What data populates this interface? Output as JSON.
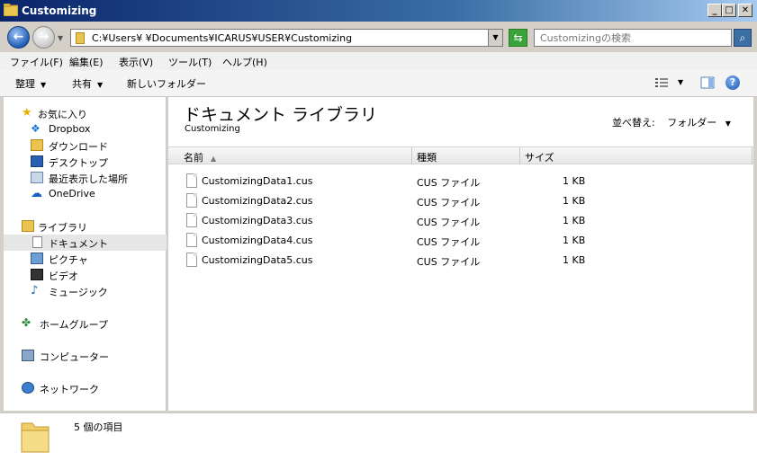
{
  "window": {
    "title": "Customizing"
  },
  "window_buttons": {
    "minimize": "_",
    "maximize": "□",
    "close": "✕"
  },
  "address": {
    "path": "C:¥Users¥    ¥Documents¥ICARUS¥USER¥Customizing"
  },
  "search": {
    "placeholder": "Customizingの検索"
  },
  "menu": {
    "items": [
      "ファイル(F)",
      "編集(E)",
      "表示(V)",
      "ツール(T)",
      "ヘルプ(H)"
    ]
  },
  "toolbar": {
    "organize": "整理",
    "share": "共有",
    "new_folder": "新しいフォルダー"
  },
  "nav": {
    "favorites": "お気に入り",
    "dropbox": "Dropbox",
    "downloads": "ダウンロード",
    "desktop": "デスクトップ",
    "recent": "最近表示した場所",
    "onedrive": "OneDrive",
    "libraries": "ライブラリ",
    "documents": "ドキュメント",
    "pictures": "ピクチャ",
    "videos": "ビデオ",
    "music": "ミュージック",
    "homegroup": "ホームグループ",
    "computer": "コンピューター",
    "network": "ネットワーク"
  },
  "library": {
    "title": "ドキュメント ライブラリ",
    "subtitle": "Customizing",
    "sort_label": "並べ替え:",
    "sort_value": "フォルダー"
  },
  "columns": {
    "name": "名前",
    "type": "種類",
    "size": "サイズ"
  },
  "files": [
    {
      "name": "CustomizingData1.cus",
      "type": "CUS ファイル",
      "size": "1 KB"
    },
    {
      "name": "CustomizingData2.cus",
      "type": "CUS ファイル",
      "size": "1 KB"
    },
    {
      "name": "CustomizingData3.cus",
      "type": "CUS ファイル",
      "size": "1 KB"
    },
    {
      "name": "CustomizingData4.cus",
      "type": "CUS ファイル",
      "size": "1 KB"
    },
    {
      "name": "CustomizingData5.cus",
      "type": "CUS ファイル",
      "size": "1 KB"
    }
  ],
  "status": {
    "count": "5 個の項目"
  }
}
